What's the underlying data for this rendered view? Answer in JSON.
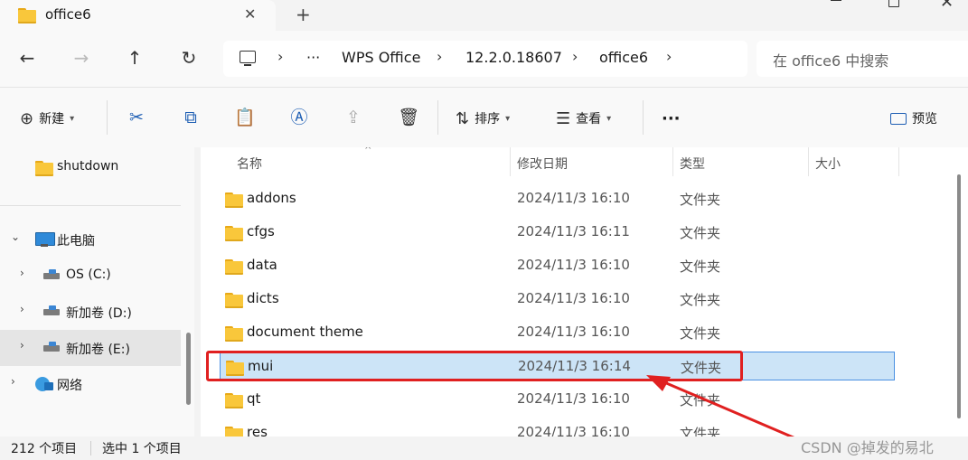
{
  "window": {
    "tab_title": "office6",
    "tab_close": "✕",
    "new_tab": "+"
  },
  "nav": {
    "back": "←",
    "forward": "→",
    "up": "↑",
    "refresh": "↻"
  },
  "address": {
    "ellipsis": "···",
    "crumbs": [
      "WPS Office",
      "12.2.0.18607",
      "office6"
    ],
    "separator": "›"
  },
  "search": {
    "placeholder": "在 office6 中搜索"
  },
  "toolbar": {
    "new_label": "新建",
    "sort_label": "排序",
    "view_label": "查看",
    "more_label": "···",
    "preview_label": "预览"
  },
  "sidebar": {
    "items": [
      {
        "label": "shutdown"
      },
      {
        "label": "此电脑"
      },
      {
        "label": "OS (C:)"
      },
      {
        "label": "新加卷 (D:)"
      },
      {
        "label": "新加卷 (E:)"
      },
      {
        "label": "网络"
      }
    ]
  },
  "columns": {
    "name": "名称",
    "modified": "修改日期",
    "type": "类型",
    "size": "大小"
  },
  "files": [
    {
      "name": "addons",
      "modified": "2024/11/3 16:10",
      "type": "文件夹"
    },
    {
      "name": "cfgs",
      "modified": "2024/11/3 16:11",
      "type": "文件夹"
    },
    {
      "name": "data",
      "modified": "2024/11/3 16:10",
      "type": "文件夹"
    },
    {
      "name": "dicts",
      "modified": "2024/11/3 16:10",
      "type": "文件夹"
    },
    {
      "name": "document theme",
      "modified": "2024/11/3 16:10",
      "type": "文件夹"
    },
    {
      "name": "mui",
      "modified": "2024/11/3 16:14",
      "type": "文件夹",
      "selected": true
    },
    {
      "name": "qt",
      "modified": "2024/11/3 16:10",
      "type": "文件夹"
    },
    {
      "name": "res",
      "modified": "2024/11/3 16:10",
      "type": "文件夹"
    }
  ],
  "status": {
    "item_count": "212 个项目",
    "selection": "选中 1 个项目"
  },
  "watermark": "CSDN @掉发的易北",
  "colors": {
    "selection_bg": "#cce4f7",
    "annotation_red": "#e02020",
    "folder_yellow": "#f9c73b"
  }
}
